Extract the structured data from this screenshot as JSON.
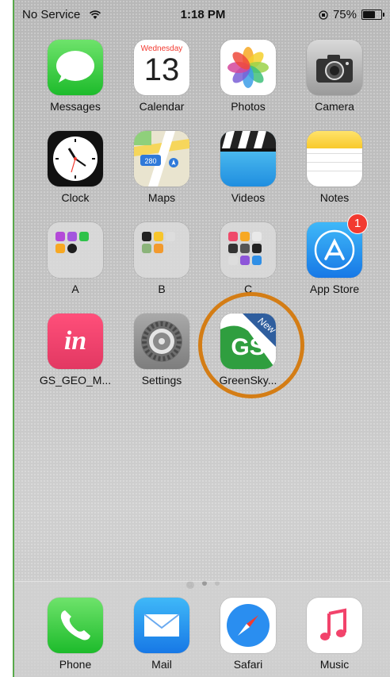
{
  "status_bar": {
    "carrier": "No Service",
    "time": "1:18 PM",
    "battery": "75%",
    "battery_level": 0.75
  },
  "apps": {
    "messages": "Messages",
    "calendar": "Calendar",
    "calendar_day": "Wednesday",
    "calendar_date": "13",
    "photos": "Photos",
    "camera": "Camera",
    "clock": "Clock",
    "maps": "Maps",
    "maps_route": "280",
    "videos": "Videos",
    "notes": "Notes",
    "folder_a": "A",
    "folder_b": "B",
    "folder_c": "C",
    "app_store": "App Store",
    "app_store_badge": "1",
    "invision": "GS_GEO_M...",
    "invision_logo": "in",
    "settings": "Settings",
    "greensky": "GreenSky...",
    "greensky_logo": "GS",
    "greensky_ribbon": "New"
  },
  "dock": {
    "phone": "Phone",
    "mail": "Mail",
    "safari": "Safari",
    "music": "Music"
  },
  "colors": {
    "highlight_ring": "#d47d15",
    "badge": "#f23a30",
    "greensky_green": "#2f9e3f"
  }
}
